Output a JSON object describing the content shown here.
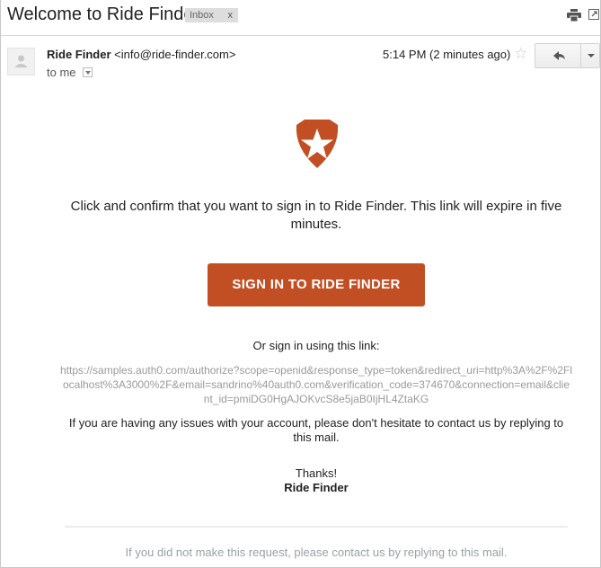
{
  "email": {
    "subject": "Welcome to Ride Finder",
    "labels": [
      {
        "name": "Inbox",
        "remove_glyph": "x"
      }
    ],
    "toolbar_icons": [
      "print-icon",
      "open-in-new-window-icon"
    ],
    "sender": {
      "name": "Ride Finder",
      "address": "<info@ride-finder.com>",
      "recipient_text": "to me",
      "avatar_icon": "person-icon"
    },
    "timestamp": "5:14 PM (2 minutes ago)",
    "star_icon": "☆",
    "reply_icon": "reply-icon",
    "more_icon": "chevron-down-icon"
  },
  "message": {
    "logo_icon": "shield-star-logo",
    "brand_color": "#c14f23",
    "intro": "Click and confirm that you want to sign in to Ride Finder. This link will expire in five minutes.",
    "cta_label": "SIGN IN TO RIDE FINDER",
    "or_label": "Or sign in using this link:",
    "link": "https://samples.auth0.com/authorize?scope=openid&response_type=token&redirect_uri=http%3A%2F%2Flocalhost%3A3000%2F&email=sandrino%40auth0.com&verification_code=374670&connection=email&client_id=pmiDG0HgAJOKvcS8e5jaB0IjHL4ZtaKG",
    "issues": "If you are having any issues with your account, please don't hesitate to contact us by replying to this mail.",
    "thanks": "Thanks!",
    "signature": "Ride Finder",
    "footer_note": "If you did not make this request, please contact us by replying to this mail."
  }
}
